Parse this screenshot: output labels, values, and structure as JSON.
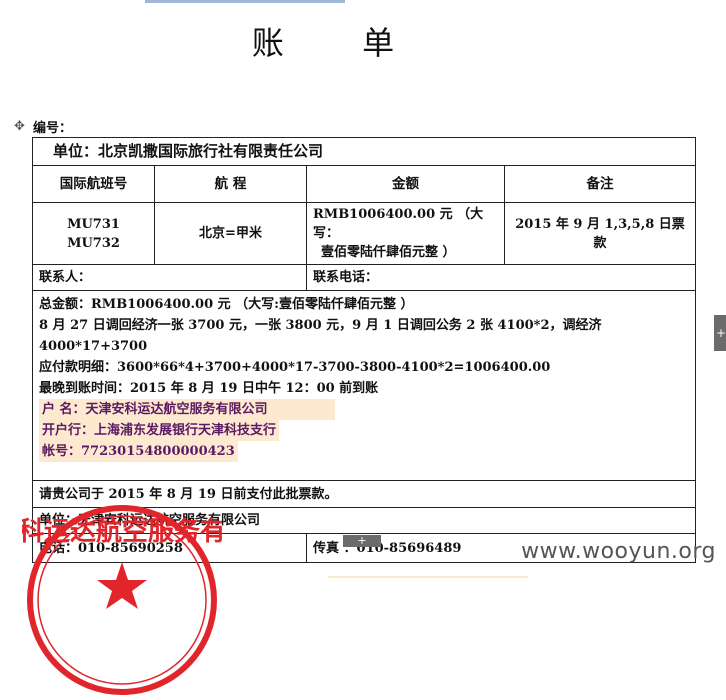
{
  "title": "账 单",
  "number_label": "编号：",
  "unit": "单位：北京凯撒国际旅行社有限责任公司",
  "headers": [
    "国际航班号",
    "航 程",
    "金额",
    "备注"
  ],
  "flight": {
    "numbers": [
      "MU731",
      "MU732"
    ],
    "route": "北京=甲米",
    "amount": [
      "RMB1006400.00 元 （大写：",
      "壹佰零陆仟肆佰元整 ）"
    ],
    "remark": "2015 年 9 月 1,3,5,8 日票款"
  },
  "contact_person": "联系人：",
  "contact_phone": "联系电话：",
  "details": [
    "总金额：RMB1006400.00 元 （大写:壹佰零陆仟肆佰元整 ）",
    "8 月 27 日调回经济一张 3700 元，一张 3800 元，9 月 1 日调回公务 2 张 4100*2，调经济 4000*17+3700",
    "应付款明细：3600*66*4+3700+4000*17-3700-3800-4100*2=1006400.00",
    "最晚到账时间：2015 年 8 月 19 日中午 12：00 前到账"
  ],
  "account": {
    "name": "户 名：天津安科运达航空服务有限公司",
    "bank": "开户行：上海浦东发展银行天津科技支行",
    "number": "帐号：77230154800000423"
  },
  "notice": "请贵公司于 2015 年 8 月 19 日前支付此批票款。",
  "issuer": "单位：天津安科运达航空服务有限公司",
  "phone": "电话：010-85690258",
  "fax": "传真 ：010-85696489",
  "stamp_text": "天津安科运达航空服务有限公司",
  "watermark": "www.wooyun.org",
  "colors": {
    "stamp": "#e0252b",
    "highlight": "#fde9cf",
    "account_text": "#5b1a64"
  },
  "icons": {
    "move": "move-handle-icon",
    "stamp": "company-seal",
    "side_tab": "plus-icon"
  }
}
